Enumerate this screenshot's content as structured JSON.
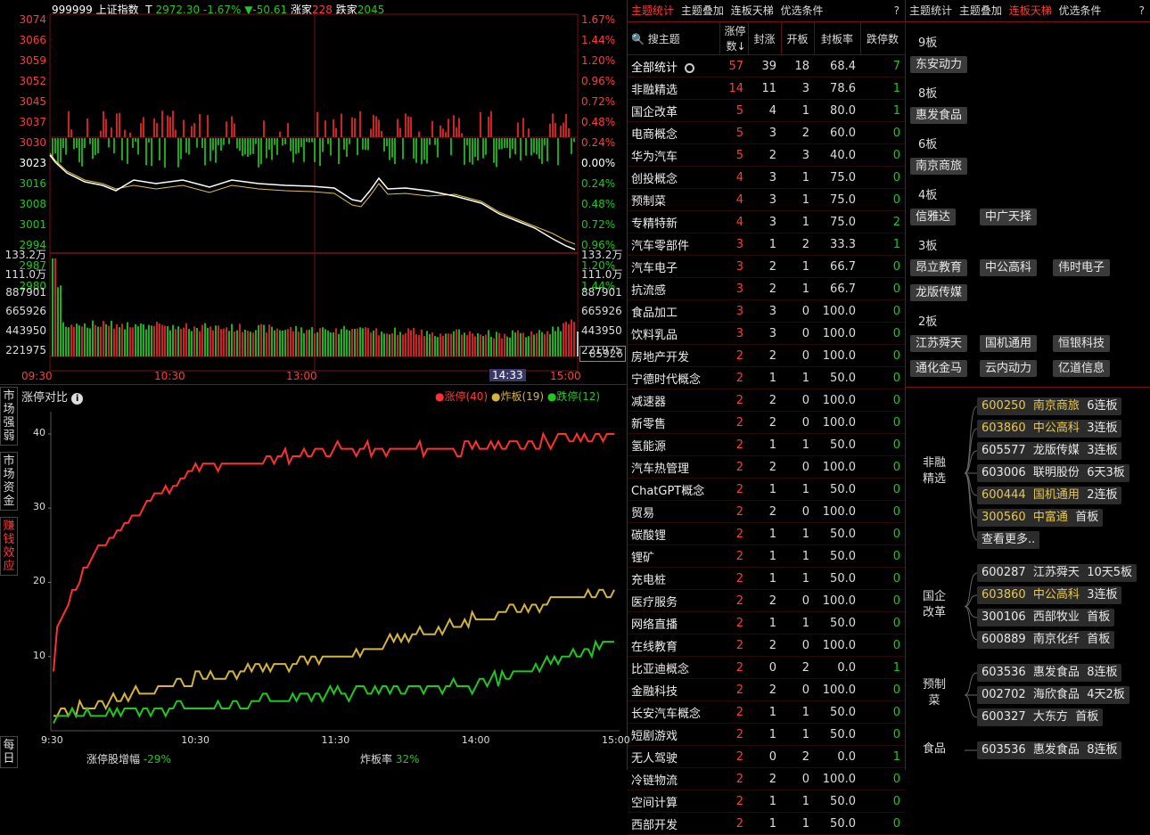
{
  "index": {
    "code": "999999",
    "name": "上证指数",
    "price_label": "T",
    "price": "2972.30",
    "pct": "-1.67%",
    "change": "▼-50.61",
    "up_label": "涨家",
    "up_count": "228",
    "down_label": "跌家",
    "down_count": "2045",
    "left_axis": [
      "3074",
      "3066",
      "3059",
      "3052",
      "3045",
      "3037",
      "3030",
      "3023",
      "3016",
      "3008",
      "3001",
      "2994",
      "2987",
      "2980"
    ],
    "right_axis": [
      "1.67%",
      "1.44%",
      "1.20%",
      "0.96%",
      "0.72%",
      "0.48%",
      "0.24%",
      "0.00%",
      "0.24%",
      "0.48%",
      "0.72%",
      "0.96%",
      "1.20%",
      "1.44%"
    ],
    "vol_axis": [
      "133.2万",
      "111.0万",
      "887901",
      "665926",
      "443950",
      "221975"
    ],
    "vol_current": "85926",
    "time_labels": [
      "09:30",
      "10:30",
      "13:00",
      "14:33",
      "15:00"
    ]
  },
  "compare": {
    "title": "涨停对比",
    "legend": [
      {
        "label": "涨停(40)",
        "color": "#ff3030"
      },
      {
        "label": "炸板(19)",
        "color": "#d4b43c"
      },
      {
        "label": "跌停(12)",
        "color": "#1ec81e"
      }
    ],
    "side_buttons": [
      "市场强弱",
      "市场资金",
      "赚钱效应",
      "每日"
    ],
    "y_ticks": [
      "40",
      "30",
      "20",
      "10"
    ],
    "x_ticks": [
      "9:30",
      "10:30",
      "11:30",
      "14:00",
      "15:00"
    ],
    "footer_left_label": "涨停股增幅",
    "footer_left_value": "-29%",
    "footer_right_label": "炸板率",
    "footer_right_value": "32%"
  },
  "chart_data": {
    "type": "line",
    "x": [
      "9:30",
      "10:30",
      "11:30",
      "14:00",
      "15:00"
    ],
    "y_ticks": [
      10,
      20,
      30,
      40
    ],
    "series": [
      {
        "name": "涨停(40)",
        "color": "#ff3030",
        "values": [
          8,
          35,
          38,
          38,
          40
        ]
      },
      {
        "name": "炸板(19)",
        "color": "#d4b43c",
        "values": [
          2,
          7,
          10,
          15,
          19
        ]
      },
      {
        "name": "跌停(12)",
        "color": "#1ec81e",
        "values": [
          2,
          3,
          5,
          6,
          12
        ]
      }
    ]
  },
  "mid": {
    "tabs": [
      "主题统计",
      "主题叠加",
      "连板天梯",
      "优选条件"
    ],
    "active_tab": 0,
    "help": "?",
    "search_label": "搜主题",
    "columns": [
      "涨停数↓",
      "封涨",
      "开板",
      "封板率",
      "跌停数"
    ],
    "rows": [
      [
        "全部统计",
        "57",
        "39",
        "18",
        "68.4",
        "7"
      ],
      [
        "非融精选",
        "14",
        "11",
        "3",
        "78.6",
        "1"
      ],
      [
        "国企改革",
        "5",
        "4",
        "1",
        "80.0",
        "1"
      ],
      [
        "电商概念",
        "5",
        "3",
        "2",
        "60.0",
        "0"
      ],
      [
        "华为汽车",
        "5",
        "2",
        "3",
        "40.0",
        "0"
      ],
      [
        "创投概念",
        "4",
        "3",
        "1",
        "75.0",
        "0"
      ],
      [
        "预制菜",
        "4",
        "3",
        "1",
        "75.0",
        "0"
      ],
      [
        "专精特新",
        "4",
        "3",
        "1",
        "75.0",
        "2"
      ],
      [
        "汽车零部件",
        "3",
        "1",
        "2",
        "33.3",
        "1"
      ],
      [
        "汽车电子",
        "3",
        "2",
        "1",
        "66.7",
        "0"
      ],
      [
        "抗流感",
        "3",
        "2",
        "1",
        "66.7",
        "0"
      ],
      [
        "食品加工",
        "3",
        "3",
        "0",
        "100.0",
        "0"
      ],
      [
        "饮料乳品",
        "3",
        "3",
        "0",
        "100.0",
        "0"
      ],
      [
        "房地产开发",
        "2",
        "2",
        "0",
        "100.0",
        "0"
      ],
      [
        "宁德时代概念",
        "2",
        "1",
        "1",
        "50.0",
        "0"
      ],
      [
        "减速器",
        "2",
        "2",
        "0",
        "100.0",
        "0"
      ],
      [
        "新零售",
        "2",
        "2",
        "0",
        "100.0",
        "0"
      ],
      [
        "氢能源",
        "2",
        "1",
        "1",
        "50.0",
        "0"
      ],
      [
        "汽车热管理",
        "2",
        "2",
        "0",
        "100.0",
        "0"
      ],
      [
        "ChatGPT概念",
        "2",
        "1",
        "1",
        "50.0",
        "0"
      ],
      [
        "贸易",
        "2",
        "2",
        "0",
        "100.0",
        "0"
      ],
      [
        "碳酸锂",
        "2",
        "1",
        "1",
        "50.0",
        "0"
      ],
      [
        "锂矿",
        "2",
        "1",
        "1",
        "50.0",
        "0"
      ],
      [
        "充电桩",
        "2",
        "1",
        "1",
        "50.0",
        "0"
      ],
      [
        "医疗服务",
        "2",
        "2",
        "0",
        "100.0",
        "0"
      ],
      [
        "网络直播",
        "2",
        "1",
        "1",
        "50.0",
        "0"
      ],
      [
        "在线教育",
        "2",
        "2",
        "0",
        "100.0",
        "0"
      ],
      [
        "比亚迪概念",
        "2",
        "0",
        "2",
        "0.0",
        "1"
      ],
      [
        "金融科技",
        "2",
        "2",
        "0",
        "100.0",
        "0"
      ],
      [
        "长安汽车概念",
        "2",
        "1",
        "1",
        "50.0",
        "0"
      ],
      [
        "短剧游戏",
        "2",
        "1",
        "1",
        "50.0",
        "0"
      ],
      [
        "无人驾驶",
        "2",
        "0",
        "2",
        "0.0",
        "1"
      ],
      [
        "冷链物流",
        "2",
        "2",
        "0",
        "100.0",
        "0"
      ],
      [
        "空间计算",
        "2",
        "1",
        "1",
        "50.0",
        "0"
      ],
      [
        "西部开发",
        "2",
        "1",
        "1",
        "50.0",
        "0"
      ]
    ]
  },
  "right": {
    "tabs": [
      "主题统计",
      "主题叠加",
      "连板天梯",
      "优选条件"
    ],
    "active_tab": 2,
    "help": "?",
    "levels": [
      {
        "label": "9板",
        "stocks": [
          "东安动力"
        ]
      },
      {
        "label": "8板",
        "stocks": [
          "惠发食品"
        ]
      },
      {
        "label": "6板",
        "stocks": [
          "南京商旅"
        ]
      },
      {
        "label": "4板",
        "stocks": [
          "信雅达",
          "中广天择"
        ]
      },
      {
        "label": "3板",
        "stocks": [
          "昂立教育",
          "中公高科",
          "伟时电子",
          "龙版传媒"
        ]
      },
      {
        "label": "2板",
        "stocks": [
          "江苏舜天",
          "国机通用",
          "恒银科技",
          "通化金马",
          "云内动力",
          "亿道信息"
        ]
      }
    ],
    "groups": [
      {
        "name": "非融精选",
        "items": [
          {
            "code": "600250",
            "name": "南京商旅",
            "tag": "6连板",
            "hl": true
          },
          {
            "code": "603860",
            "name": "中公高科",
            "tag": "3连板",
            "hl": true
          },
          {
            "code": "605577",
            "name": "龙版传媒",
            "tag": "3连板",
            "hl": false
          },
          {
            "code": "603006",
            "name": "联明股份",
            "tag": "6天3板",
            "hl": false
          },
          {
            "code": "600444",
            "name": "国机通用",
            "tag": "2连板",
            "hl": true
          },
          {
            "code": "300560",
            "name": "中富通",
            "tag": "首板",
            "hl": true
          }
        ],
        "more": "查看更多.."
      },
      {
        "name": "国企改革",
        "items": [
          {
            "code": "600287",
            "name": "江苏舜天",
            "tag": "10天5板",
            "hl": false
          },
          {
            "code": "603860",
            "name": "中公高科",
            "tag": "3连板",
            "hl": true
          },
          {
            "code": "300106",
            "name": "西部牧业",
            "tag": "首板",
            "hl": false
          },
          {
            "code": "600889",
            "name": "南京化纤",
            "tag": "首板",
            "hl": false
          }
        ]
      },
      {
        "name": "预制菜",
        "items": [
          {
            "code": "603536",
            "name": "惠发食品",
            "tag": "8连板",
            "hl": false
          },
          {
            "code": "002702",
            "name": "海欣食品",
            "tag": "4天2板",
            "hl": false
          },
          {
            "code": "600327",
            "name": "大东方",
            "tag": "首板",
            "hl": false
          }
        ]
      },
      {
        "name": "食品",
        "items": [
          {
            "code": "603536",
            "name": "惠发食品",
            "tag": "8连板",
            "hl": false
          }
        ]
      }
    ]
  }
}
